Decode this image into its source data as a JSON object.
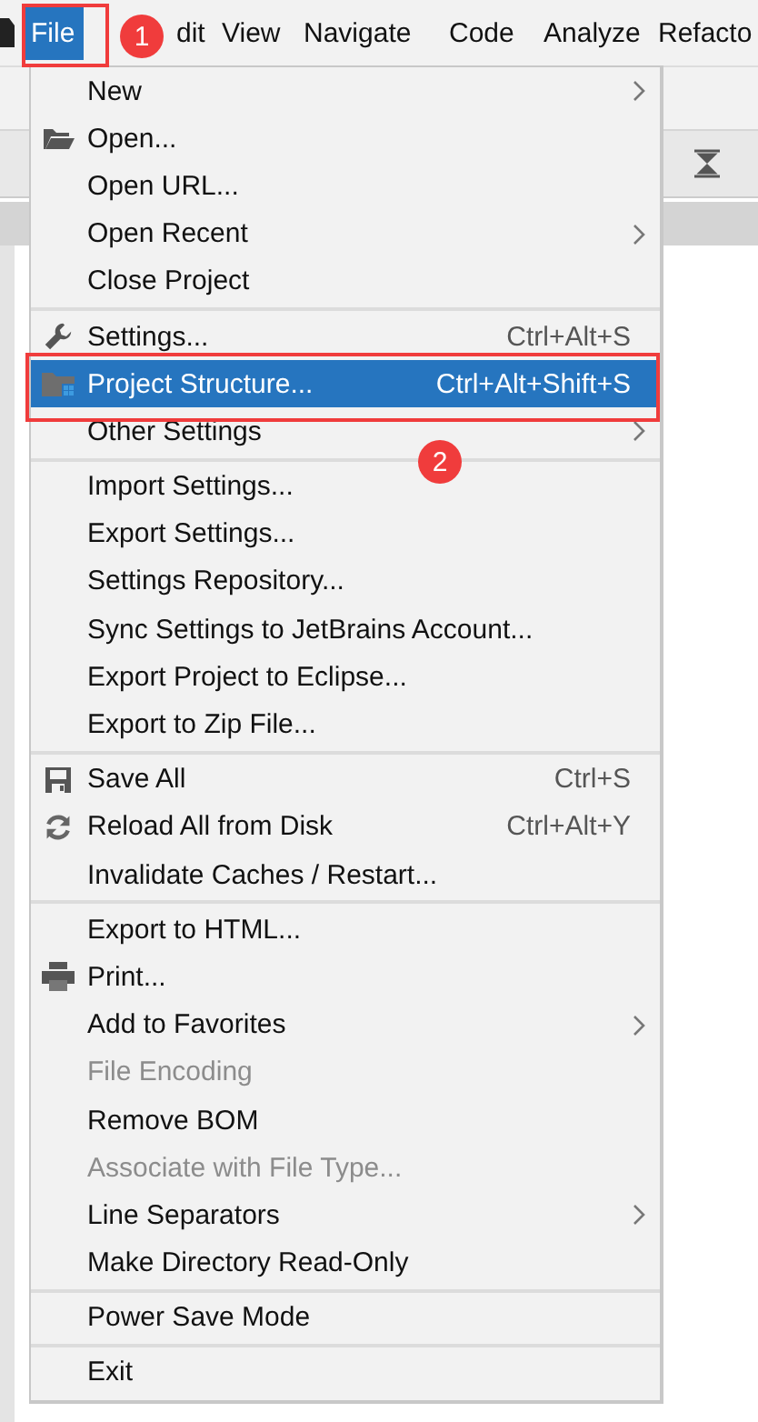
{
  "menubar": [
    {
      "label": "File",
      "selected": true
    },
    {
      "label": "dit",
      "selected": false
    },
    {
      "label": "View",
      "selected": false
    },
    {
      "label": "Navigate",
      "selected": false
    },
    {
      "label": "Code",
      "selected": false
    },
    {
      "label": "Analyze",
      "selected": false
    },
    {
      "label": "Refacto",
      "selected": false
    }
  ],
  "menu": {
    "sections": [
      [
        {
          "label": "New",
          "submenu": true,
          "kind": "plain",
          "disabled": false,
          "selected": false
        },
        {
          "label": "Open...",
          "submenu": false,
          "kind": "folder",
          "disabled": false,
          "selected": false
        },
        {
          "label": "Open URL...",
          "submenu": false,
          "kind": "plain",
          "disabled": false,
          "selected": false
        },
        {
          "label": "Open Recent",
          "submenu": true,
          "kind": "plain",
          "disabled": false,
          "selected": false
        },
        {
          "label": "Close Project",
          "submenu": false,
          "kind": "plain",
          "disabled": false,
          "selected": false
        }
      ],
      [
        {
          "label": "Settings...",
          "shortcut": "Ctrl+Alt+S",
          "submenu": false,
          "kind": "wrench",
          "disabled": false,
          "selected": false
        },
        {
          "label": "Project Structure...",
          "shortcut": "Ctrl+Alt+Shift+S",
          "submenu": false,
          "kind": "structure",
          "disabled": false,
          "selected": true
        },
        {
          "label": "Other Settings",
          "submenu": true,
          "kind": "plain",
          "disabled": false,
          "selected": false
        }
      ],
      [
        {
          "label": "Import Settings...",
          "submenu": false,
          "kind": "plain",
          "disabled": false,
          "selected": false
        },
        {
          "label": "Export Settings...",
          "submenu": false,
          "kind": "plain",
          "disabled": false,
          "selected": false
        },
        {
          "label": "Settings Repository...",
          "submenu": false,
          "kind": "plain",
          "disabled": false,
          "selected": false
        },
        {
          "label": "Sync Settings to JetBrains Account...",
          "submenu": false,
          "kind": "plain",
          "disabled": false,
          "selected": false
        },
        {
          "label": "Export Project to Eclipse...",
          "submenu": false,
          "kind": "plain",
          "disabled": false,
          "selected": false
        },
        {
          "label": "Export to Zip File...",
          "submenu": false,
          "kind": "plain",
          "disabled": false,
          "selected": false
        }
      ],
      [
        {
          "label": "Save All",
          "shortcut": "Ctrl+S",
          "submenu": false,
          "kind": "disk",
          "disabled": false,
          "selected": false
        },
        {
          "label": "Reload All from Disk",
          "shortcut": "Ctrl+Alt+Y",
          "submenu": false,
          "kind": "reload",
          "disabled": false,
          "selected": false
        },
        {
          "label": "Invalidate Caches / Restart...",
          "submenu": false,
          "kind": "plain",
          "disabled": false,
          "selected": false
        }
      ],
      [
        {
          "label": "Export to HTML...",
          "submenu": false,
          "kind": "plain",
          "disabled": false,
          "selected": false
        },
        {
          "label": "Print...",
          "submenu": false,
          "kind": "printer",
          "disabled": false,
          "selected": false
        },
        {
          "label": "Add to Favorites",
          "submenu": true,
          "kind": "plain",
          "disabled": false,
          "selected": false
        },
        {
          "label": "File Encoding",
          "submenu": false,
          "kind": "plain",
          "disabled": true,
          "selected": false
        },
        {
          "label": "Remove BOM",
          "submenu": false,
          "kind": "plain",
          "disabled": false,
          "selected": false
        },
        {
          "label": "Associate with File Type...",
          "submenu": false,
          "kind": "plain",
          "disabled": true,
          "selected": false
        },
        {
          "label": "Line Separators",
          "submenu": true,
          "kind": "plain",
          "disabled": false,
          "selected": false
        },
        {
          "label": "Make Directory Read-Only",
          "submenu": false,
          "kind": "plain",
          "disabled": false,
          "selected": false
        }
      ],
      [
        {
          "label": "Power Save Mode",
          "submenu": false,
          "kind": "plain",
          "disabled": false,
          "selected": false
        }
      ],
      [
        {
          "label": "Exit",
          "submenu": false,
          "kind": "plain",
          "disabled": false,
          "selected": false
        }
      ]
    ]
  },
  "callouts": [
    {
      "label": "1"
    },
    {
      "label": "2"
    }
  ]
}
